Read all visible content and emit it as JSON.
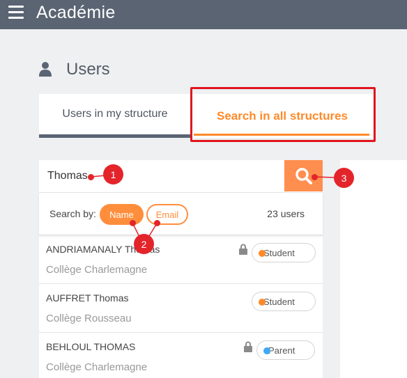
{
  "header": {
    "app_title": "Académie"
  },
  "page": {
    "title": "Users"
  },
  "tabs": [
    {
      "label": "Users in my structure",
      "active": false
    },
    {
      "label": "Search in all structures",
      "active": true
    }
  ],
  "search": {
    "value": "Thomas",
    "placeholder": ""
  },
  "search_by": {
    "label": "Search by:",
    "options": [
      {
        "label": "Name",
        "selected": true
      },
      {
        "label": "Email",
        "selected": false
      }
    ],
    "count": "23 users"
  },
  "users": [
    {
      "name": "ANDRIAMANALY Thomas",
      "school": "Collège Charlemagne",
      "role": "Student",
      "role_color": "#ff8a2a",
      "locked": true
    },
    {
      "name": "AUFFRET Thomas",
      "school": "Collège Rousseau",
      "role": "Student",
      "role_color": "#ff8a2a",
      "locked": false
    },
    {
      "name": "BEHLOUL THOMAS",
      "school": "Collège Charlemagne",
      "role": "Parent",
      "role_color": "#3fa9f5",
      "locked": true
    }
  ],
  "annotations": {
    "marker_1": "1",
    "marker_2": "2",
    "marker_3": "3"
  },
  "colors": {
    "accent": "#ff8a2a",
    "topbar": "#5b6472",
    "annotation": "#e4242b"
  }
}
